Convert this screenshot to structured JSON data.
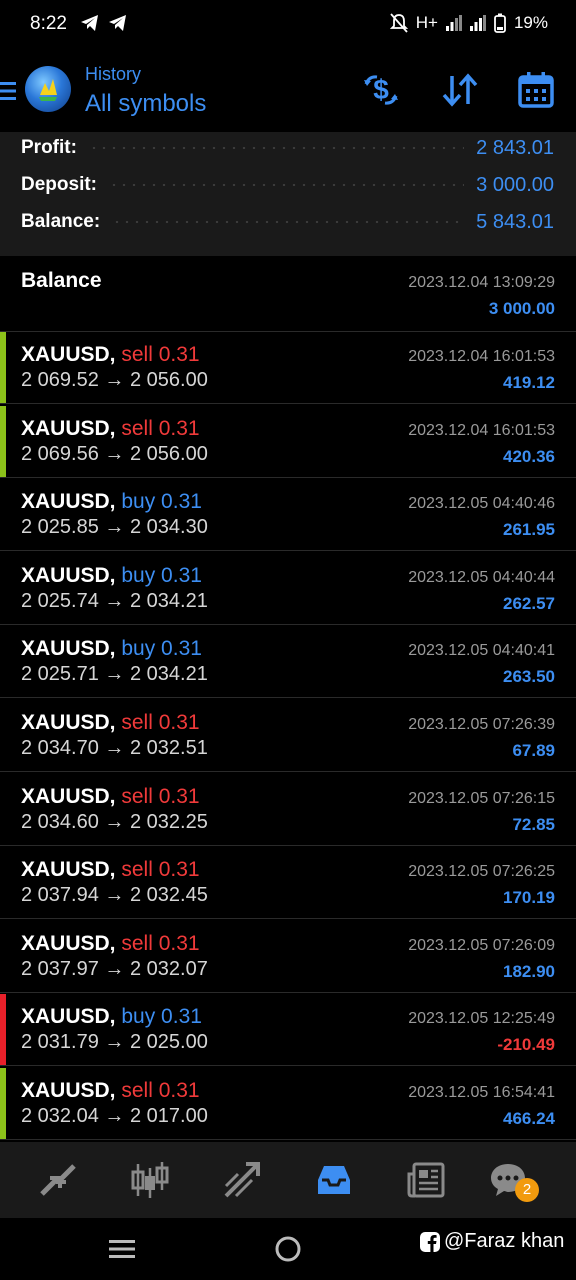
{
  "status_bar": {
    "time": "8:22",
    "network": "H+",
    "battery": "19%"
  },
  "header": {
    "subtitle": "History",
    "title": "All symbols"
  },
  "summary": [
    {
      "label": "Profit:",
      "value": "2 843.01"
    },
    {
      "label": "Deposit:",
      "value": "3 000.00"
    },
    {
      "label": "Balance:",
      "value": "5 843.01"
    }
  ],
  "balance_entry": {
    "label": "Balance",
    "time": "2023.12.04 13:09:29",
    "amount": "3 000.00"
  },
  "trades": [
    {
      "symbol": "XAUUSD,",
      "side": "sell 0.31",
      "open": "2 069.52",
      "close": "2 056.00",
      "time": "2023.12.04 16:01:53",
      "profit": "419.12"
    },
    {
      "symbol": "XAUUSD,",
      "side": "sell 0.31",
      "open": "2 069.56",
      "close": "2 056.00",
      "time": "2023.12.04 16:01:53",
      "profit": "420.36"
    },
    {
      "symbol": "XAUUSD,",
      "side": "buy 0.31",
      "open": "2 025.85",
      "close": "2 034.30",
      "time": "2023.12.05 04:40:46",
      "profit": "261.95"
    },
    {
      "symbol": "XAUUSD,",
      "side": "buy 0.31",
      "open": "2 025.74",
      "close": "2 034.21",
      "time": "2023.12.05 04:40:44",
      "profit": "262.57"
    },
    {
      "symbol": "XAUUSD,",
      "side": "buy 0.31",
      "open": "2 025.71",
      "close": "2 034.21",
      "time": "2023.12.05 04:40:41",
      "profit": "263.50"
    },
    {
      "symbol": "XAUUSD,",
      "side": "sell 0.31",
      "open": "2 034.70",
      "close": "2 032.51",
      "time": "2023.12.05 07:26:39",
      "profit": "67.89"
    },
    {
      "symbol": "XAUUSD,",
      "side": "sell 0.31",
      "open": "2 034.60",
      "close": "2 032.25",
      "time": "2023.12.05 07:26:15",
      "profit": "72.85"
    },
    {
      "symbol": "XAUUSD,",
      "side": "sell 0.31",
      "open": "2 037.94",
      "close": "2 032.45",
      "time": "2023.12.05 07:26:25",
      "profit": "170.19"
    },
    {
      "symbol": "XAUUSD,",
      "side": "sell 0.31",
      "open": "2 037.97",
      "close": "2 032.07",
      "time": "2023.12.05 07:26:09",
      "profit": "182.90"
    },
    {
      "symbol": "XAUUSD,",
      "side": "buy 0.31",
      "open": "2 031.79",
      "close": "2 025.00",
      "time": "2023.12.05 12:25:49",
      "profit": "-210.49"
    },
    {
      "symbol": "XAUUSD,",
      "side": "sell 0.31",
      "open": "2 032.04",
      "close": "2 017.00",
      "time": "2023.12.05 16:54:41",
      "profit": "466.24"
    }
  ],
  "arrow": "→",
  "bottom_nav": {
    "items": [
      "quotes-icon",
      "chart-icon",
      "trade-icon",
      "history-icon",
      "news-icon",
      "chat-icon"
    ],
    "active": "history-icon",
    "chat_badge": "2"
  },
  "watermark": "@Faraz khan",
  "colors": {
    "accent_blue": "#3d8ef2",
    "sell_red": "#f03a3a",
    "buy_blue": "#3d8ef2",
    "profit_bar": "#8cc21a",
    "loss_bar": "#e8202a"
  }
}
